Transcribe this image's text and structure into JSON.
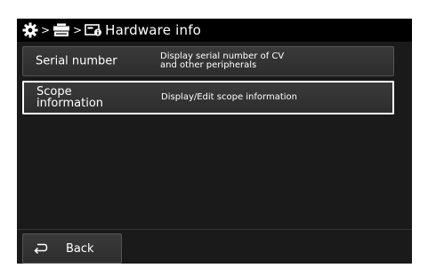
{
  "header": {
    "breadcrumb_icons": [
      "gear-icon",
      "processor-icon",
      "hardware-info-icon"
    ],
    "separator": ">",
    "title": "Hardware info"
  },
  "menu": {
    "items": [
      {
        "label": "Serial number",
        "description": "Display serial number of CV\nand other peripherals"
      },
      {
        "label": "Scope\ninformation",
        "description": "Display/Edit scope information",
        "selected": true
      }
    ]
  },
  "footer": {
    "back_label": "Back",
    "back_icon": "return-arrow-icon"
  },
  "colors": {
    "background": "#1a1a1a",
    "header_bg": "#000000",
    "button_bg": "#333333",
    "selection_border": "#ffffff",
    "text": "#ffffff"
  }
}
